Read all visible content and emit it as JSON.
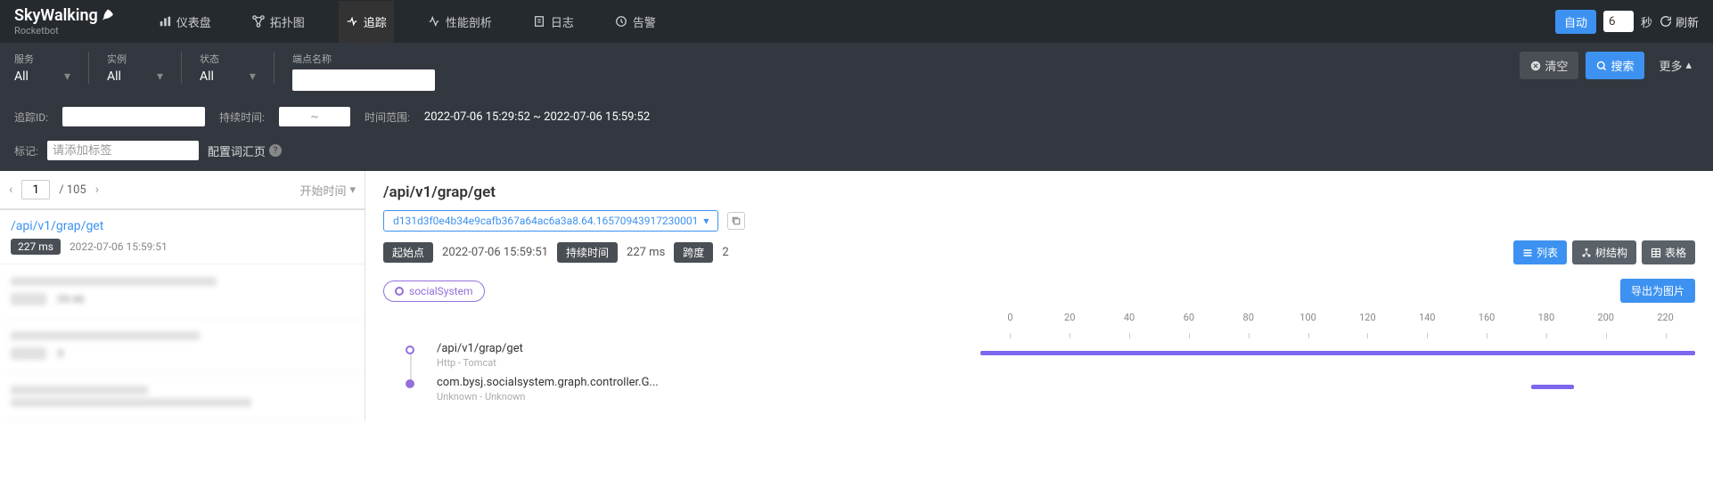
{
  "header": {
    "logo": "SkyWalking",
    "logo_sub": "Rocketbot",
    "nav": [
      {
        "label": "仪表盘"
      },
      {
        "label": "拓扑图"
      },
      {
        "label": "追踪",
        "active": true
      },
      {
        "label": "性能剖析"
      },
      {
        "label": "日志"
      },
      {
        "label": "告警"
      }
    ],
    "auto_label": "自动",
    "seconds_value": "6",
    "seconds_unit": "秒",
    "refresh_label": "刷新"
  },
  "filters": {
    "service_label": "服务",
    "service_value": "All",
    "instance_label": "实例",
    "instance_value": "All",
    "status_label": "状态",
    "status_value": "All",
    "endpoint_label": "端点名称",
    "endpoint_value": "",
    "clear_label": "清空",
    "search_label": "搜索",
    "more_label": "更多"
  },
  "filters2": {
    "trace_id_label": "追踪ID:",
    "trace_id_value": "",
    "duration_label": "持续时间:",
    "duration_placeholder": "~",
    "time_range_label": "时间范围:",
    "time_range_value": "2022-07-06 15:29:52 ~ 2022-07-06 15:59:52"
  },
  "filters3": {
    "tags_label": "标记:",
    "tags_placeholder": "请添加标签",
    "vocab_label": "配置词汇页"
  },
  "pager": {
    "current": "1",
    "total": "/ 105",
    "sort_label": "开始时间"
  },
  "trace_list": [
    {
      "path": "/api/v1/grap/get",
      "duration": "227 ms",
      "time": "2022-07-06 15:59:51",
      "active": true
    },
    {
      "blurred": true,
      "time_fragment": ":59:46"
    },
    {
      "blurred": true,
      "time_fragment": ":5"
    },
    {
      "blurred": true,
      "time_fragment": ""
    }
  ],
  "detail": {
    "title": "/api/v1/grap/get",
    "trace_id": "d131d3f0e4b34e9cafb367a64ac6a3a8.64.16570943917230001",
    "start_label": "起始点",
    "start_value": "2022-07-06 15:59:51",
    "duration_label": "持续时间",
    "duration_value": "227 ms",
    "span_label": "跨度",
    "span_value": "2",
    "view_list": "列表",
    "view_tree": "树结构",
    "view_table": "表格",
    "service_name": "socialSystem",
    "export_label": "导出为图片",
    "ticks": [
      "0",
      "20",
      "40",
      "60",
      "80",
      "100",
      "120",
      "140",
      "160",
      "180",
      "200",
      "220"
    ],
    "spans": [
      {
        "name": "/api/v1/grap/get",
        "sub": "Http - Tomcat",
        "left": "0%",
        "width": "100%",
        "filled": false
      },
      {
        "name": "com.bysj.socialsystem.graph.controller.G...",
        "sub": "Unknown - Unknown",
        "left": "77%",
        "width": "6%",
        "filled": true
      }
    ]
  }
}
